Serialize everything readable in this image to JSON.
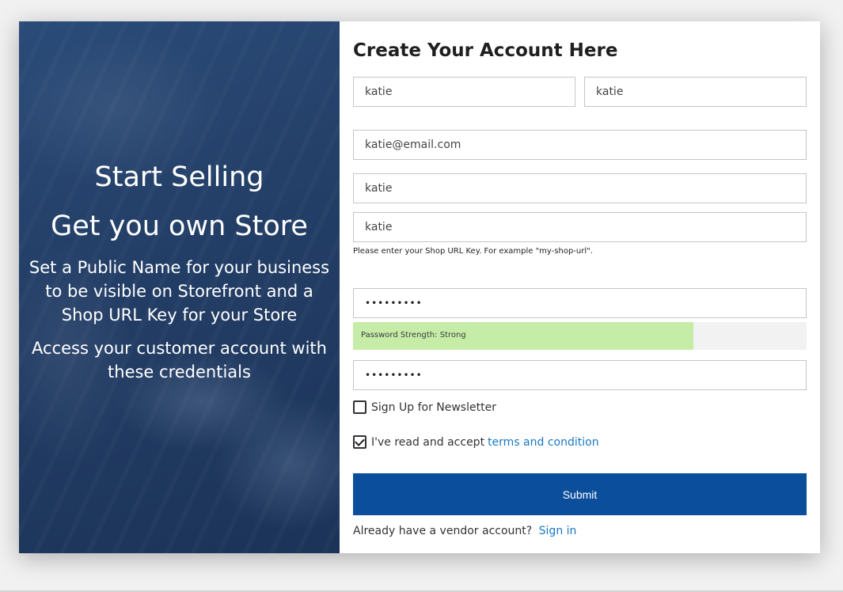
{
  "promo": {
    "heading_line1": "Start Selling",
    "heading_line2": "Get you own Store",
    "text1": "Set a Public Name for your business to be visible on Storefront and a Shop URL Key for your Store",
    "text2": "Access your customer account with these credentials"
  },
  "form": {
    "title": "Create Your Account Here",
    "first_name": "katie",
    "last_name": "katie",
    "email": "katie@email.com",
    "public_name": "katie",
    "shop_url": "katie",
    "shop_url_hint": "Please enter your Shop URL Key. For example \"my-shop-url\".",
    "password": "•••••••••",
    "password_strength": {
      "label": "Password Strength: Strong",
      "level": 0.75,
      "color": "#c6eda8"
    },
    "confirm_password": "•••••••••",
    "newsletter": {
      "label": "Sign Up for Newsletter",
      "checked": false
    },
    "terms": {
      "label": "I've read and accept",
      "link": "terms and condition",
      "checked": true
    },
    "submit_label": "Submit",
    "signin_prompt": "Already have a vendor account?",
    "signin_link": "Sign in"
  },
  "colors": {
    "accent": "#0b4f9c",
    "link": "#1979c3",
    "panel": "#233e66"
  }
}
